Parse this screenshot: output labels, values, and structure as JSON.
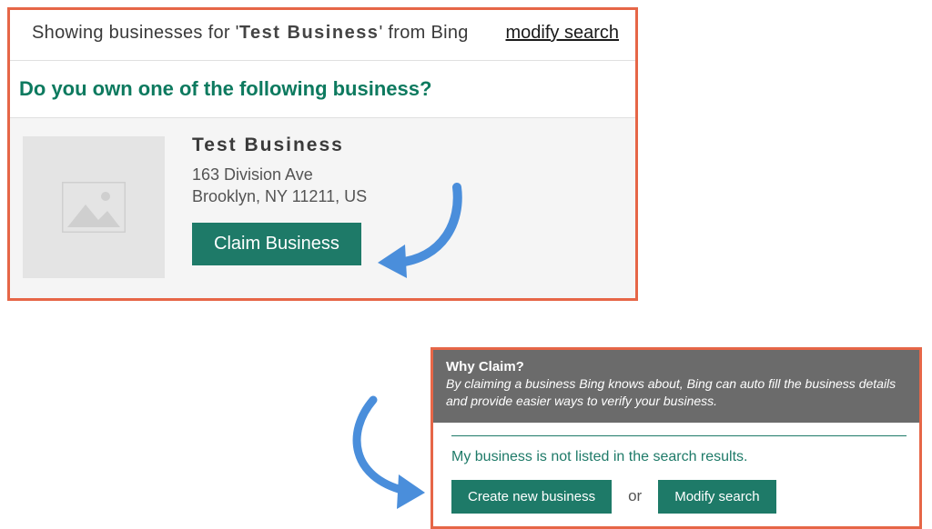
{
  "top": {
    "showing_prefix": "Showing businesses for '",
    "query": "Test Business",
    "showing_suffix": "' from Bing",
    "modify_link": "modify search",
    "question": "Do you own one of the following business?"
  },
  "result": {
    "name": "Test Business",
    "address_line1": "163 Division Ave",
    "address_line2": "Brooklyn, NY 11211, US",
    "claim_label": "Claim Business"
  },
  "why": {
    "title": "Why Claim?",
    "desc": "By claiming a business Bing knows about, Bing can auto fill the business details and provide easier ways to verify your business."
  },
  "bottom": {
    "not_listed": "My business is not listed in the search results.",
    "create_label": "Create new business",
    "or": "or",
    "modify_label": "Modify search"
  }
}
